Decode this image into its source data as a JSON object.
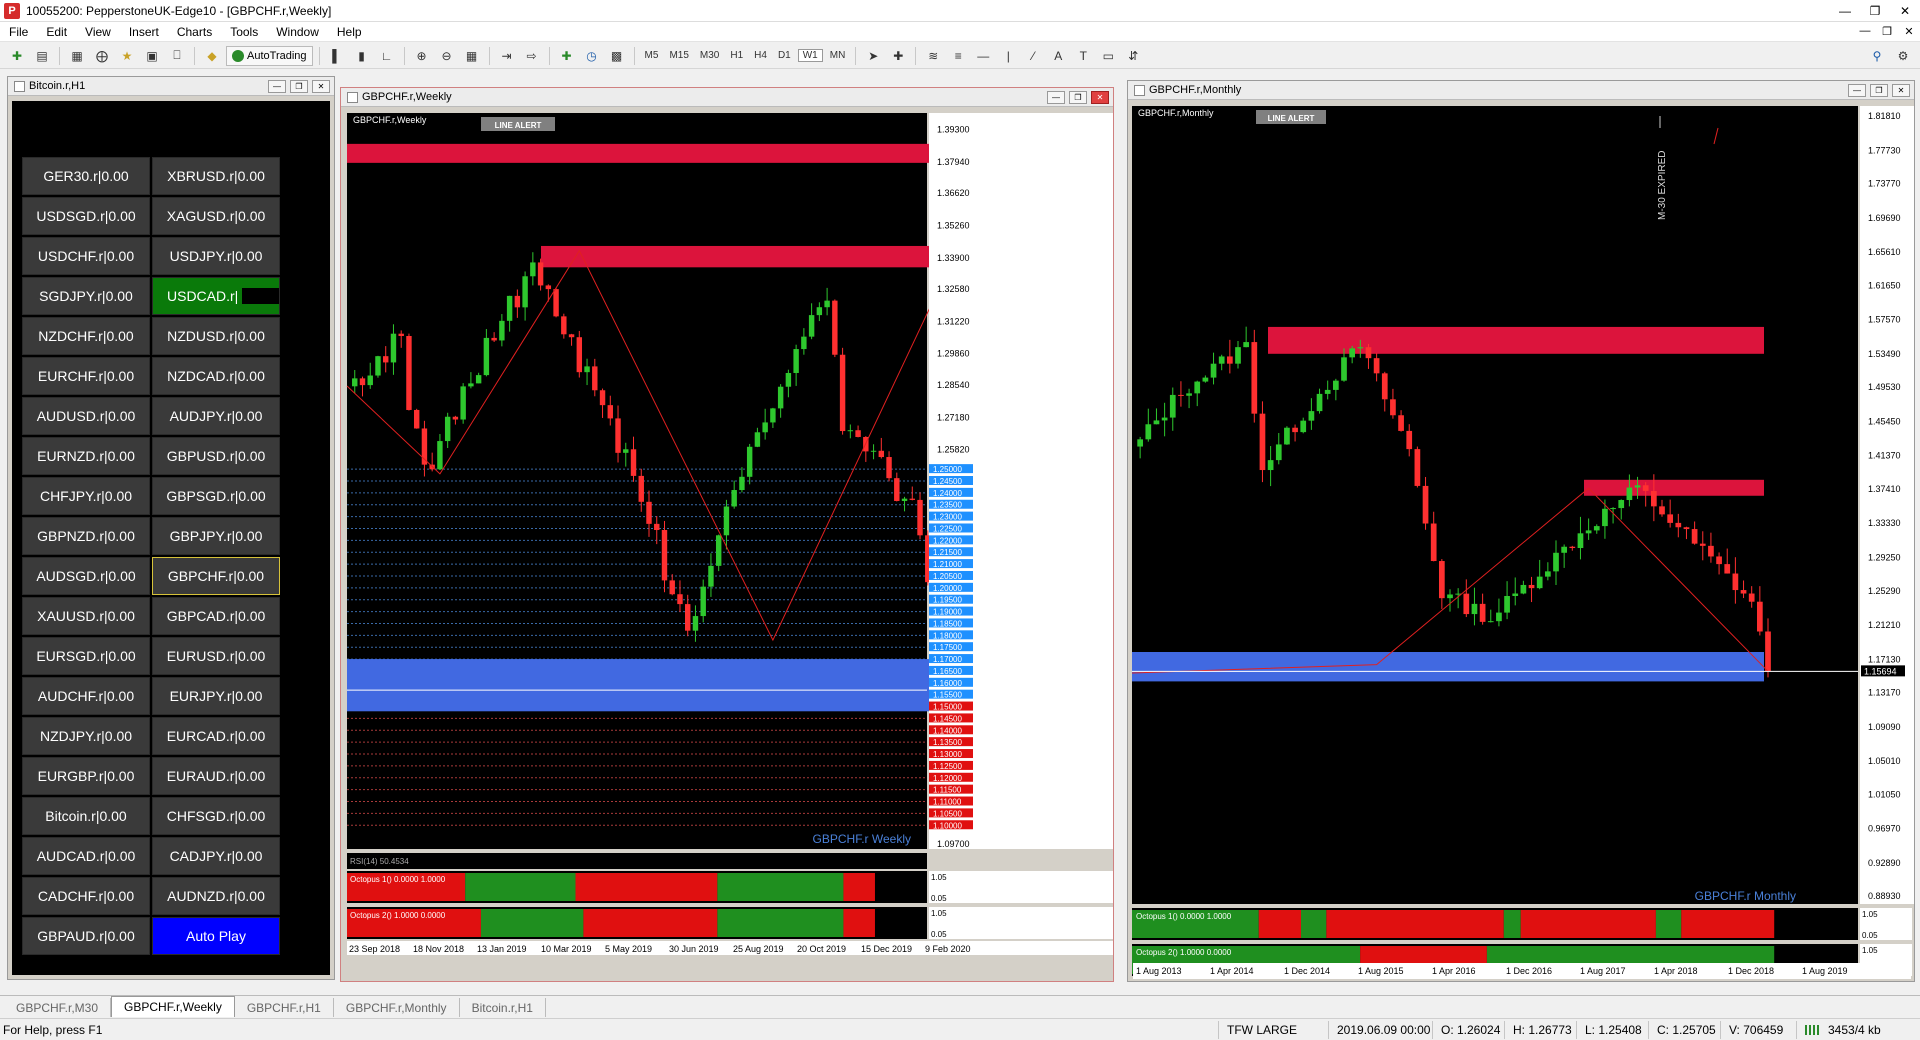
{
  "window": {
    "title": "10055200: PepperstoneUK-Edge10 - [GBPCHF.r,Weekly]"
  },
  "menu": [
    "File",
    "Edit",
    "View",
    "Insert",
    "Charts",
    "Tools",
    "Window",
    "Help"
  ],
  "toolbar": {
    "autotrading": "AutoTrading",
    "timeframes": [
      "M5",
      "M15",
      "M30",
      "H1",
      "H4",
      "D1",
      "W1",
      "MN"
    ]
  },
  "bitcoin_window": {
    "title": "Bitcoin.r,H1",
    "symbols": [
      "GER30.r|0.00",
      "XBRUSD.r|0.00",
      "USDSGD.r|0.00",
      "XAGUSD.r|0.00",
      "USDCHF.r|0.00",
      "USDJPY.r|0.00",
      "SGDJPY.r|0.00",
      "USDCAD.r|",
      "NZDCHF.r|0.00",
      "NZDUSD.r|0.00",
      "EURCHF.r|0.00",
      "NZDCAD.r|0.00",
      "AUDUSD.r|0.00",
      "AUDJPY.r|0.00",
      "EURNZD.r|0.00",
      "GBPUSD.r|0.00",
      "CHFJPY.r|0.00",
      "GBPSGD.r|0.00",
      "GBPNZD.r|0.00",
      "GBPJPY.r|0.00",
      "AUDSGD.r|0.00",
      "GBPCHF.r|0.00",
      "XAUUSD.r|0.00",
      "GBPCAD.r|0.00",
      "EURSGD.r|0.00",
      "EURUSD.r|0.00",
      "AUDCHF.r|0.00",
      "EURJPY.r|0.00",
      "NZDJPY.r|0.00",
      "EURCAD.r|0.00",
      "EURGBP.r|0.00",
      "EURAUD.r|0.00",
      "Bitcoin.r|0.00",
      "CHFSGD.r|0.00",
      "AUDCAD.r|0.00",
      "CADJPY.r|0.00",
      "CADCHF.r|0.00",
      "AUDNZD.r|0.00",
      "GBPAUD.r|0.00",
      "Auto Play"
    ]
  },
  "weekly_window": {
    "title": "GBPCHF.r,Weekly",
    "chart_label": "GBPCHF.r,Weekly",
    "line_alert": "LINE ALERT",
    "watermark": "GBPCHF.r Weekly",
    "ind1": "Octopus 1() 0.0000 1.0000",
    "ind2": "Octopus 2() 1.0000 0.0000",
    "ind_scale": [
      "1.05",
      "0.05",
      "1.05",
      "0.05"
    ],
    "rsi_label": "RSI(14) 50.4534"
  },
  "monthly_window": {
    "title": "GBPCHF.r,Monthly",
    "chart_label": "GBPCHF.r,Monthly",
    "line_alert": "LINE ALERT",
    "expired": "M-30 EXPIRED",
    "watermark": "GBPCHF.r Monthly",
    "ind1": "Octopus 1() 0.0000 1.0000",
    "ind2": "Octopus 2() 1.0000 0.0000",
    "ind_scale": [
      "1.05",
      "0.05",
      "1.05",
      "0.05"
    ]
  },
  "chart_data": [
    {
      "type": "candlestick",
      "title": "GBPCHF.r,Weekly",
      "x_labels": [
        "23 Sep 2018",
        "18 Nov 2018",
        "13 Jan 2019",
        "10 Mar 2019",
        "5 May 2019",
        "30 Jun 2019",
        "25 Aug 2019",
        "20 Oct 2019",
        "15 Dec 2019",
        "9 Feb 2020"
      ],
      "y_ticks": [
        "1.39300",
        "1.37940",
        "1.36620",
        "1.35260",
        "1.33900",
        "1.32580",
        "1.31220",
        "1.29860",
        "1.28540",
        "1.27180",
        "1.25820"
      ],
      "level_labels_blue": [
        "1.25000",
        "1.24500",
        "1.24000",
        "1.23500",
        "1.23000",
        "1.22500",
        "1.22000",
        "1.21500",
        "1.21000",
        "1.20500",
        "1.20000",
        "1.19500",
        "1.19000",
        "1.18500",
        "1.18000",
        "1.17500",
        "1.17000",
        "1.16500",
        "1.16000",
        "1.15500"
      ],
      "level_labels_red": [
        "1.15000",
        "1.14500",
        "1.14000",
        "1.13500",
        "1.13000",
        "1.12500",
        "1.12000",
        "1.11500",
        "1.11000",
        "1.10500",
        "1.10000"
      ],
      "y_bottom_tick": "1.09700",
      "ylim": [
        1.09,
        1.4
      ],
      "close": 1.15694
    },
    {
      "type": "candlestick",
      "title": "GBPCHF.r,Monthly",
      "x_labels": [
        "1 Aug 2013",
        "1 Apr 2014",
        "1 Dec 2014",
        "1 Aug 2015",
        "1 Apr 2016",
        "1 Dec 2016",
        "1 Aug 2017",
        "1 Apr 2018",
        "1 Dec 2018",
        "1 Aug 2019"
      ],
      "y_ticks": [
        "1.81810",
        "1.77730",
        "1.73770",
        "1.69690",
        "1.65610",
        "1.61650",
        "1.57570",
        "1.53490",
        "1.49530",
        "1.45450",
        "1.41370",
        "1.37410",
        "1.33330",
        "1.29250",
        "1.25290",
        "1.21210",
        "1.17130",
        "1.13170",
        "1.09090",
        "1.05010",
        "1.01050",
        "0.96970",
        "0.92890",
        "0.88930"
      ],
      "current_price": "1.15694",
      "ylim": [
        0.88,
        1.83
      ]
    }
  ],
  "tabs": [
    "GBPCHF.r,M30",
    "GBPCHF.r,Weekly",
    "GBPCHF.r,H1",
    "GBPCHF.r,Monthly",
    "Bitcoin.r,H1"
  ],
  "active_tab": 1,
  "status": {
    "help": "For Help, press F1",
    "profile": "TFW LARGE",
    "time": "2019.06.09 00:00",
    "open": "O: 1.26024",
    "high": "H: 1.26773",
    "low": "L: 1.25408",
    "close": "C: 1.25705",
    "volume": "V: 706459",
    "traffic": "3453/4 kb"
  }
}
